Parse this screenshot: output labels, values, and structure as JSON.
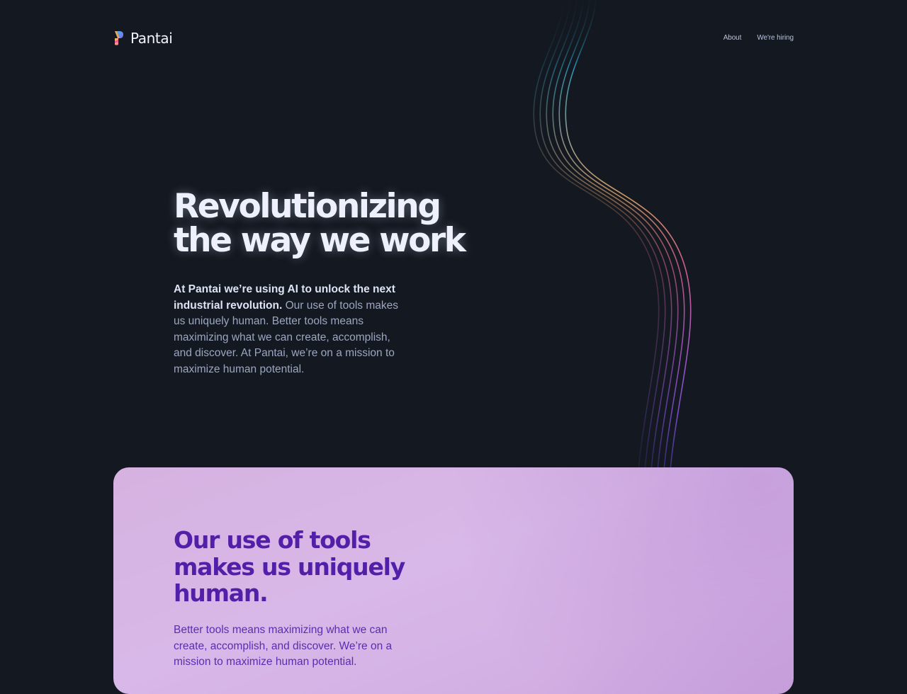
{
  "header": {
    "brand": "Pantai",
    "nav": [
      {
        "label": "About"
      },
      {
        "label": "We're hiring"
      }
    ]
  },
  "hero": {
    "title_line1": "Revolutionizing",
    "title_line2": "the way we work",
    "body_lead": "At Pantai we’re using AI to unlock the next industrial revolution.",
    "body_rest": " Our use of tools makes us uniquely human. Better tools means maximizing what we can create, accomplish, and discover. At Pantai, we’re on a mission to maximize human potential."
  },
  "feature": {
    "title_line1": "Our use of tools",
    "title_line2": "makes us uniquely",
    "title_line3": "human.",
    "body": "Better tools means maximizing what we can create, accomplish, and discover. We’re on a mission to maximize human potential."
  },
  "colors": {
    "background": "#141820",
    "card": "#d7b6e6",
    "card_heading": "#5220a8",
    "line_gradient": [
      "#2aa6c8",
      "#f0b070",
      "#f06a9a",
      "#b060e0"
    ]
  }
}
